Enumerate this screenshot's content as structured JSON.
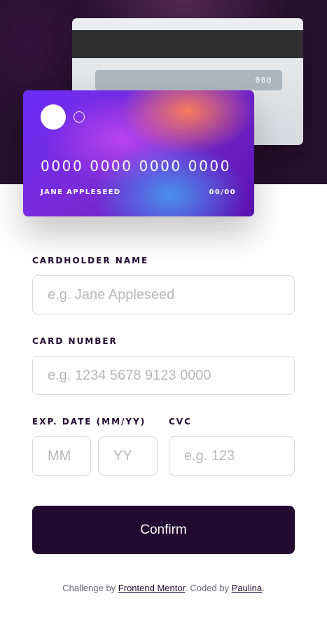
{
  "card_back": {
    "cvc_display": "000"
  },
  "card_front": {
    "number_display": "0000 0000 0000 0000",
    "name_display": "JANE APPLESEED",
    "expiry_display": "00/00"
  },
  "form": {
    "cardholder": {
      "label": "CARDHOLDER NAME",
      "placeholder": "e.g. Jane Appleseed"
    },
    "card_number": {
      "label": "CARD NUMBER",
      "placeholder": "e.g. 1234 5678 9123 0000"
    },
    "expiry": {
      "label": "EXP. DATE (MM/YY)",
      "month_placeholder": "MM",
      "year_placeholder": "YY"
    },
    "cvc": {
      "label": "CVC",
      "placeholder": "e.g. 123"
    },
    "confirm_label": "Confirm"
  },
  "footer": {
    "prefix": "Challenge by ",
    "challenge_link": "Frontend Mentor",
    "middle": ". Coded by ",
    "author_link": "Paulina",
    "suffix": "."
  },
  "colors": {
    "background_dark": "#27102e",
    "text_dark": "#21092f",
    "border": "#d9d7dc",
    "placeholder": "#b9b8bc"
  }
}
